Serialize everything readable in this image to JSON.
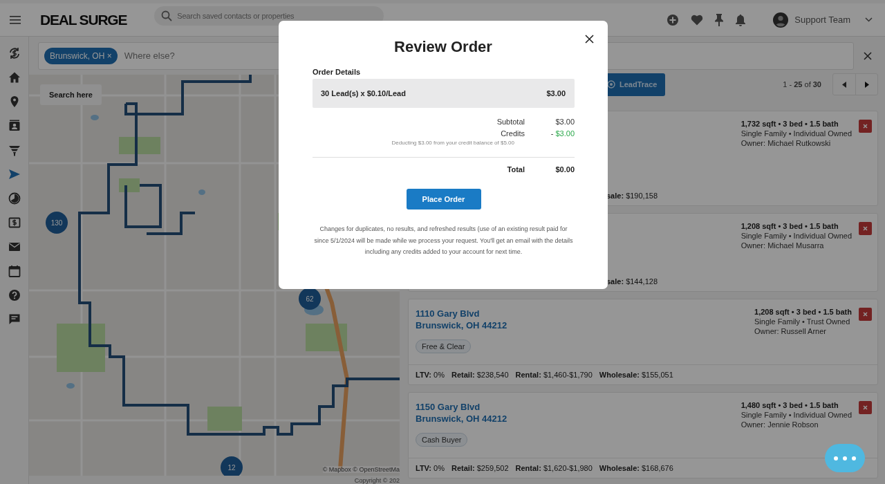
{
  "header": {
    "logo": "DEAL SURGE",
    "search": {
      "placeholder": "Search saved contacts or properties"
    },
    "user": "Support Team"
  },
  "sidebar": {
    "items": [
      {
        "selected": false
      },
      {
        "selected": false
      },
      {
        "selected": false
      },
      {
        "selected": false
      },
      {
        "selected": false
      },
      {
        "selected": true
      },
      {
        "selected": false
      },
      {
        "selected": false
      },
      {
        "selected": false
      },
      {
        "selected": false
      },
      {
        "selected": false
      },
      {
        "selected": false
      }
    ]
  },
  "filter": {
    "chips": [
      "Brunswick, OH"
    ],
    "chip_remove": "×",
    "placeholder": "Where else?"
  },
  "map": {
    "search_button": "Search here",
    "clusters": [
      {
        "count": "130"
      },
      {
        "count": "62"
      },
      {
        "count": "12"
      }
    ],
    "attribution": "© Mapbox © OpenStreetMa"
  },
  "footer": "Copyright © 202",
  "results": {
    "leadtrace_button": "LeadTrace",
    "pagination": "1 - **25** of **30**",
    "cards": [
      {
        "specs": "1,732 sqft • 3 bed • 1.5 bath",
        "type": "Single Family • Individual Owned",
        "owner": "Owner: Michael Rutkowski",
        "stats": [
          {
            "label": "sale:",
            "value": "$190,158"
          }
        ]
      },
      {
        "specs": "1,208 sqft • 3 bed • 1.5 bath",
        "type": "Single Family • Individual Owned",
        "owner": "Owner: Michael Musarra",
        "stats": [
          {
            "label": "sale:",
            "value": "$144,128"
          }
        ]
      },
      {
        "address": [
          "1110 Gary Blvd",
          "Brunswick, OH 44212"
        ],
        "tag": "Free & Clear",
        "specs": "1,208 sqft • 3 bed • 1.5 bath",
        "type": "Single Family • Trust Owned",
        "owner": "Owner: Russell Arner",
        "stats": [
          {
            "label": "LTV:",
            "value": "0%"
          },
          {
            "label": "Retail:",
            "value": "$238,540"
          },
          {
            "label": "Rental:",
            "value": "$1,460-$1,790"
          },
          {
            "label": "Wholesale:",
            "value": "$155,051"
          }
        ]
      },
      {
        "address": [
          "1150 Gary Blvd",
          "Brunswick, OH 44212"
        ],
        "tag": "Cash Buyer",
        "specs": "1,480 sqft • 3 bed • 1.5 bath",
        "type": "Single Family • Individual Owned",
        "owner": "Owner: Jennie Robson",
        "stats": [
          {
            "label": "LTV:",
            "value": "0%"
          },
          {
            "label": "Retail:",
            "value": "$259,502"
          },
          {
            "label": "Rental:",
            "value": "$1,620-$1,980"
          },
          {
            "label": "Wholesale:",
            "value": "$168,676"
          }
        ]
      }
    ]
  },
  "modal": {
    "title": "Review Order",
    "section_label": "Order Details",
    "line_item": {
      "label": "30 Lead(s) x $0.10/Lead",
      "amount": "$3.00"
    },
    "summary": [
      {
        "label": "Subtotal",
        "value": "$3.00",
        "kind": "plain"
      },
      {
        "label": "Credits",
        "value": "$3.00",
        "prefix": "- ",
        "kind": "credit"
      }
    ],
    "note": "Deducting $3.00 from your credit balance of $5.00",
    "total": {
      "label": "Total",
      "value": "$0.00"
    },
    "button": "Place Order",
    "disclaimer": "Changes for duplicates, no results, and refreshed results (use of an existing result paid for since 5/1/2024 will be made while we process your request. You'll get an email with the details including any credits added to your account for next time."
  }
}
